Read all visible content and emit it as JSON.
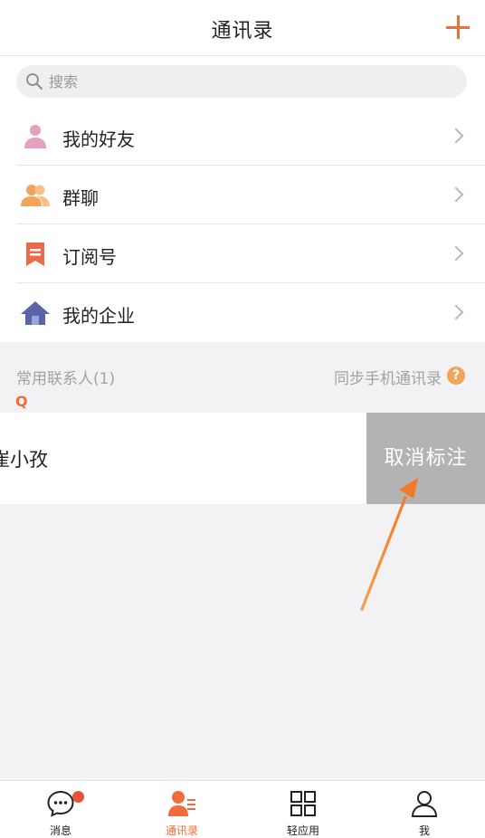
{
  "header": {
    "title": "通讯录"
  },
  "search": {
    "placeholder": "搜索"
  },
  "menu": {
    "items": [
      {
        "label": "我的好友",
        "icon": "person-icon",
        "color": "#e8a0c0"
      },
      {
        "label": "群聊",
        "icon": "group-icon",
        "color": "#f2a55a"
      },
      {
        "label": "订阅号",
        "icon": "bookmark-icon",
        "color": "#ec6a4a"
      },
      {
        "label": "我的企业",
        "icon": "home-icon",
        "color": "#5865a8"
      }
    ]
  },
  "section": {
    "frequent_title": "常用联系人(1)",
    "sync_label": "同步手机通讯录",
    "help_glyph": "?",
    "index_letter": "Q"
  },
  "contact": {
    "name": "崔小孜",
    "swipe_action": "取消标注"
  },
  "tabbar": {
    "tabs": [
      {
        "label": "消息",
        "icon": "chat-bubble-icon",
        "badge": true
      },
      {
        "label": "通讯录",
        "icon": "contacts-icon",
        "active": true
      },
      {
        "label": "轻应用",
        "icon": "grid-apps-icon"
      },
      {
        "label": "我",
        "icon": "profile-icon"
      }
    ]
  },
  "colors": {
    "accent": "#f26b3a",
    "swipe_action_bg": "#b3b3b3",
    "badge": "#e5533a",
    "annotation_arrow": "#f28a3a"
  }
}
